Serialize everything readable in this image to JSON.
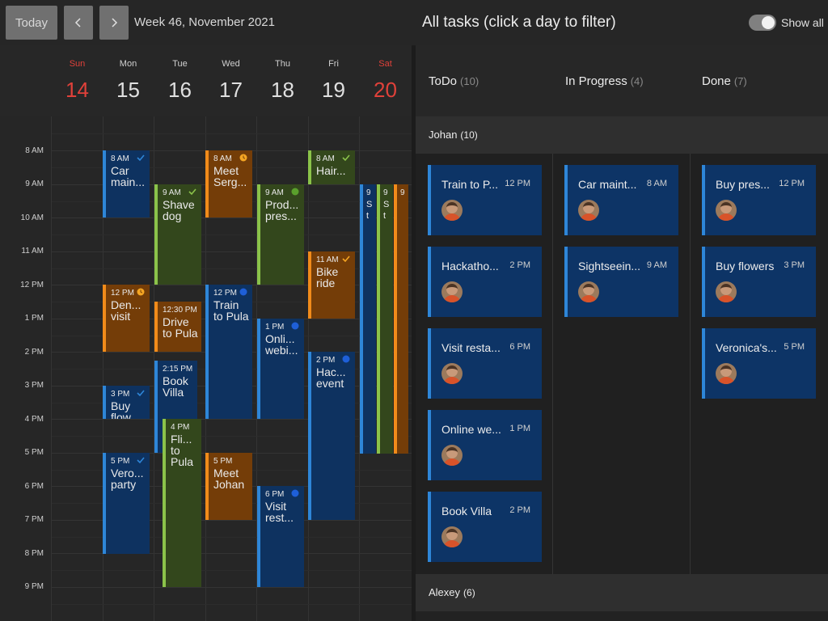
{
  "toolbar": {
    "today_label": "Today",
    "week_title": "Week 46, November 2021"
  },
  "days": [
    {
      "name": "Sun",
      "date": "14"
    },
    {
      "name": "Mon",
      "date": "15"
    },
    {
      "name": "Tue",
      "date": "16"
    },
    {
      "name": "Wed",
      "date": "17"
    },
    {
      "name": "Thu",
      "date": "18"
    },
    {
      "name": "Fri",
      "date": "19"
    },
    {
      "name": "Sat",
      "date": "20"
    }
  ],
  "time_labels": [
    "8 AM",
    "9 AM",
    "10 AM",
    "11 AM",
    "12 PM",
    "1 PM",
    "2 PM",
    "3 PM",
    "4 PM",
    "5 PM",
    "6 PM",
    "7 PM",
    "8 PM",
    "9 PM"
  ],
  "events": [
    {
      "time": "8 AM",
      "name": "Car main...",
      "color": "blue",
      "icon": "check-icon"
    },
    {
      "time": "12 PM",
      "name": "Den... visit",
      "color": "orange",
      "icon": "clock-icon"
    },
    {
      "time": "3 PM",
      "name": "Buy flow...",
      "color": "blue",
      "icon": "check-icon"
    },
    {
      "time": "5 PM",
      "name": "Vero... party",
      "color": "blue",
      "icon": "check-icon"
    },
    {
      "time": "9 AM",
      "name": "Shave dog",
      "color": "green",
      "icon": "check-icon"
    },
    {
      "time": "12:30 PM",
      "name": "Drive to Pula",
      "color": "orange",
      "icon": ""
    },
    {
      "time": "2:15 PM",
      "name": "Book Villa",
      "color": "blue",
      "icon": ""
    },
    {
      "time": "4 PM",
      "name": "Fli... to Pula",
      "color": "green",
      "icon": ""
    },
    {
      "time": "8 AM",
      "name": "Meet Serg...",
      "color": "orange",
      "icon": "clock-icon"
    },
    {
      "time": "12 PM",
      "name": "Train to Pula",
      "color": "blue",
      "icon": "dot-icon"
    },
    {
      "time": "5 PM",
      "name": "Meet Johan",
      "color": "orange",
      "icon": ""
    },
    {
      "time": "9 AM",
      "name": "Prod... pres...",
      "color": "green",
      "icon": "dot-icon"
    },
    {
      "time": "1 PM",
      "name": "Onli... webi...",
      "color": "blue",
      "icon": "dot-icon"
    },
    {
      "time": "6 PM",
      "name": "Visit rest...",
      "color": "blue",
      "icon": "dot-icon"
    },
    {
      "time": "8 AM",
      "name": "Hair...",
      "color": "green",
      "icon": "check-icon"
    },
    {
      "time": "11 AM",
      "name": "Bike ride",
      "color": "orange",
      "icon": "check-icon"
    },
    {
      "time": "2 PM",
      "name": "Hac... event",
      "color": "blue",
      "icon": "dot-icon"
    },
    {
      "time": "9",
      "name": "S t",
      "color": "blue",
      "icon": ""
    },
    {
      "time": "9",
      "name": "S t",
      "color": "green",
      "icon": ""
    },
    {
      "time": "9",
      "name": "",
      "color": "orange",
      "icon": ""
    }
  ],
  "tasks": {
    "title": "All tasks (click a day to filter)",
    "show_all_label": "Show all",
    "columns": [
      {
        "label": "ToDo",
        "count": "(10)"
      },
      {
        "label": "In Progress",
        "count": "(4)"
      },
      {
        "label": "Done",
        "count": "(7)"
      }
    ],
    "swimlanes": [
      {
        "name": "Johan",
        "count": "(10)"
      },
      {
        "name": "Alexey",
        "count": "(6)"
      }
    ],
    "todo": [
      {
        "name": "Train to P...",
        "time": "12 PM"
      },
      {
        "name": "Hackatho...",
        "time": "2 PM"
      },
      {
        "name": "Visit resta...",
        "time": "6 PM"
      },
      {
        "name": "Online we...",
        "time": "1 PM"
      },
      {
        "name": "Book Villa",
        "time": "2 PM"
      }
    ],
    "in_progress": [
      {
        "name": "Car maint...",
        "time": "8 AM"
      },
      {
        "name": "Sightseein...",
        "time": "9 AM"
      }
    ],
    "done": [
      {
        "name": "Buy pres...",
        "time": "12 PM"
      },
      {
        "name": "Buy flowers",
        "time": "3 PM"
      },
      {
        "name": "Veronica's...",
        "time": "5 PM"
      }
    ]
  },
  "colors": {
    "event_blue": "#0e3260",
    "event_blue_border": "#2e86d8",
    "event_green": "#33471c",
    "event_green_border": "#8bc34a",
    "event_orange": "#743d08",
    "event_orange_border": "#f18b1a",
    "weekend_red": "#e0413a",
    "card_bg": "#0d3466"
  }
}
